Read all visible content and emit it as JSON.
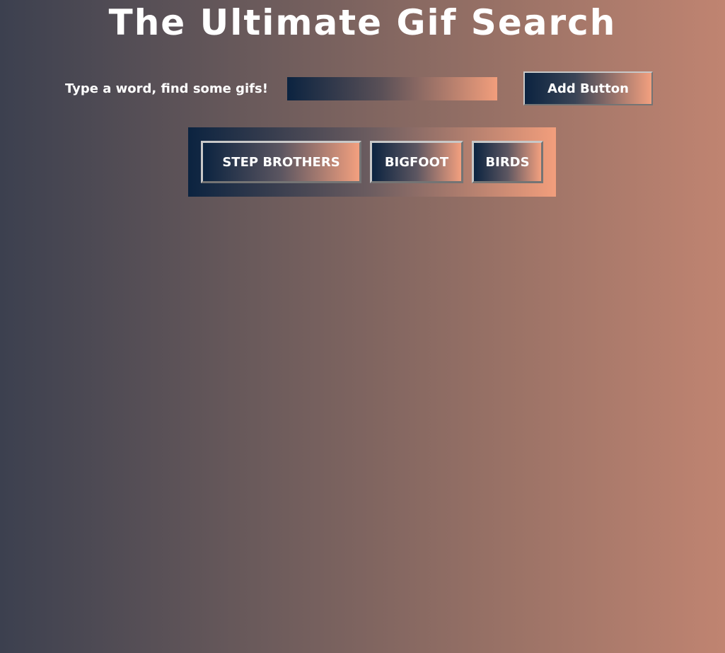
{
  "header": {
    "title": "The Ultimate Gif Search"
  },
  "search": {
    "label": "Type a word, find some gifs!",
    "value": "",
    "placeholder": "",
    "add_button_label": "Add Button"
  },
  "topics": [
    {
      "label": "STEP BROTHERS"
    },
    {
      "label": "BIGFOOT"
    },
    {
      "label": "BIRDS"
    }
  ],
  "colors": {
    "gradient_dark": "#0b2340",
    "gradient_light": "#f29e7c",
    "background_left": "#3c404f",
    "background_right": "#c08471"
  }
}
